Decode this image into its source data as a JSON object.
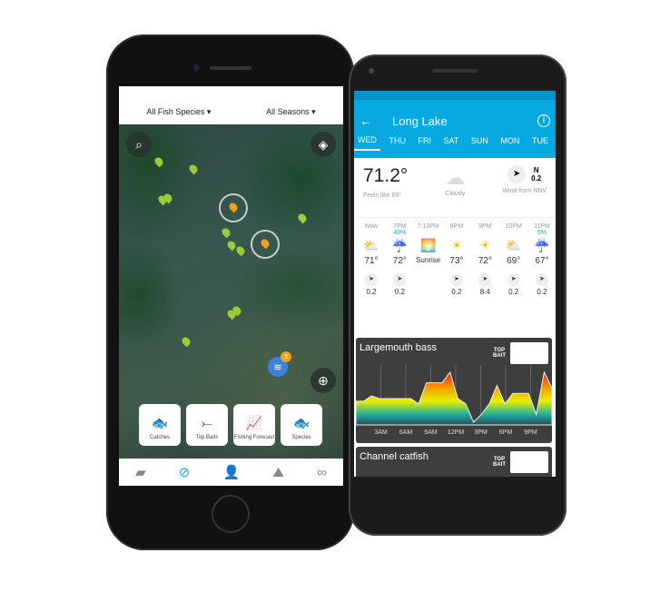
{
  "map_screen": {
    "filters": {
      "species": "All Fish Species ▾",
      "seasons": "All Seasons ▾"
    },
    "cluster_count": "3",
    "tiles": [
      {
        "label": "Catches",
        "icon": "fish-icon"
      },
      {
        "label": "Top Baits",
        "icon": "lure-icon"
      },
      {
        "label": "Fishing Forecast",
        "icon": "chart-icon"
      },
      {
        "label": "Species",
        "icon": "fish-pair-icon"
      }
    ],
    "tabbar": [
      "catch-log-icon",
      "compass-icon",
      "profile-icon",
      "forecast-icon",
      "binoculars-icon"
    ],
    "accent": "#1aa3e0"
  },
  "weather_screen": {
    "title": "Long Lake",
    "days": [
      "WED",
      "THU",
      "FRI",
      "SAT",
      "SUN",
      "MON",
      "TUE"
    ],
    "selected_day": "WED",
    "current": {
      "temp": "71.2°",
      "feels": "Feels like 69°",
      "condition": "Cloudy",
      "wind_dir": "N",
      "wind_speed": "0.2",
      "wind_label": "Wind from NNV"
    },
    "hours": [
      {
        "time": "Now",
        "precip": "",
        "icon": "partly-cloudy",
        "temp": "71°",
        "wind": "0.2"
      },
      {
        "time": "7PM",
        "precip": "40%",
        "icon": "rain",
        "temp": "72°",
        "wind": "0.2"
      },
      {
        "time": "7:13PM",
        "precip": "",
        "icon": "sunrise",
        "temp": "Sunrise",
        "wind": ""
      },
      {
        "time": "8PM",
        "precip": "",
        "icon": "sun",
        "temp": "73°",
        "wind": "0.2"
      },
      {
        "time": "9PM",
        "precip": "",
        "icon": "sun",
        "temp": "72°",
        "wind": "8.4"
      },
      {
        "time": "10PM",
        "precip": "",
        "icon": "partly-cloudy",
        "temp": "69°",
        "wind": "0.2"
      },
      {
        "time": "11PM",
        "precip": "5%",
        "icon": "rain",
        "temp": "67°",
        "wind": "0.2"
      }
    ],
    "species_cards": [
      {
        "name": "Largemouth bass",
        "top_bait": "TOP BAIT",
        "hours": [
          "3AM",
          "6AM",
          "9AM",
          "12PM",
          "3PM",
          "6PM",
          "9PM"
        ],
        "activity": [
          0.45,
          0.45,
          0.55,
          0.5,
          0.5,
          0.5,
          0.5,
          0.5,
          0.4,
          0.8,
          0.8,
          0.8,
          1.0,
          0.5,
          0.4,
          0.05,
          0.2,
          0.4,
          0.75,
          0.4,
          0.6,
          0.6,
          0.6,
          0.2,
          1.0,
          0.7
        ]
      },
      {
        "name": "Channel catfish",
        "top_bait": "TOP BAIT"
      }
    ]
  }
}
